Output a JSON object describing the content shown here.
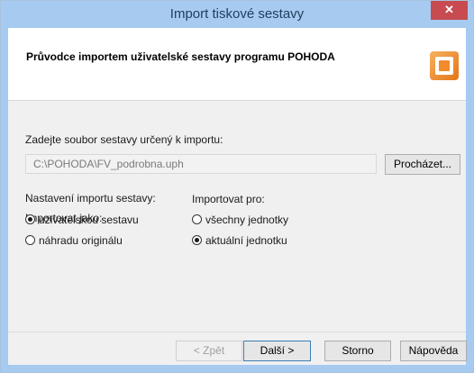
{
  "window": {
    "title": "Import tiskové sestavy",
    "close_glyph": "✕"
  },
  "header": {
    "title": "Průvodce importem uživatelské sestavy programu POHODA",
    "icon": "import-wizard-icon"
  },
  "file": {
    "label": "Zadejte soubor sestavy určený k importu:",
    "value": "C:\\POHODA\\FV_podrobna.uph",
    "browse_label": "Procházet..."
  },
  "settings": {
    "label": "Nastavení importu sestavy:",
    "import_as": {
      "label": "Importovat jako:",
      "options": [
        {
          "label": "uživatelskou sestavu",
          "checked": true
        },
        {
          "label": "náhradu originálu",
          "checked": false
        }
      ]
    },
    "import_for": {
      "label": "Importovat pro:",
      "options": [
        {
          "label": "všechny jednotky",
          "checked": false
        },
        {
          "label": "aktuální jednotku",
          "checked": true
        }
      ]
    }
  },
  "buttons": {
    "back": "< Zpět",
    "next": "Další >",
    "cancel": "Storno",
    "help": "Nápověda"
  }
}
